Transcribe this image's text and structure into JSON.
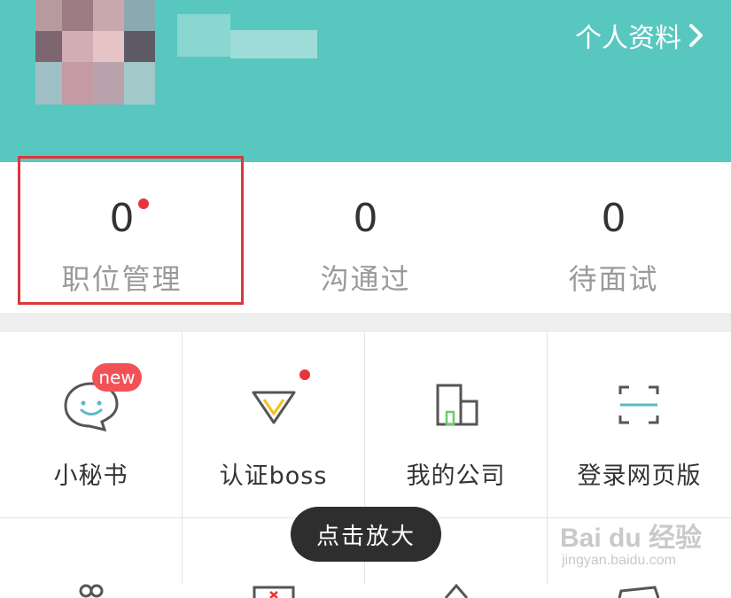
{
  "header": {
    "profile_link_label": "个人资料",
    "background_color": "#58c7c0"
  },
  "stats": [
    {
      "value": "0",
      "label": "职位管理",
      "has_dot": true,
      "highlighted": true
    },
    {
      "value": "0",
      "label": "沟通过"
    },
    {
      "value": "0",
      "label": "待面试"
    }
  ],
  "grid": [
    {
      "label": "小秘书",
      "icon": "chat-bubble-icon",
      "badge": "new"
    },
    {
      "label": "认证boss",
      "icon": "diamond-icon",
      "has_dot": true
    },
    {
      "label": "我的公司",
      "icon": "company-building-icon"
    },
    {
      "label": "登录网页版",
      "icon": "scan-frame-icon"
    }
  ],
  "overlay": {
    "zoom_label": "点击放大"
  },
  "watermark": {
    "main": "Bai du 经验",
    "sub": "jingyan.baidu.com"
  },
  "colors": {
    "accent": "#58c7c0",
    "badge_red": "#e8343b",
    "highlight_border": "#d9383d"
  }
}
